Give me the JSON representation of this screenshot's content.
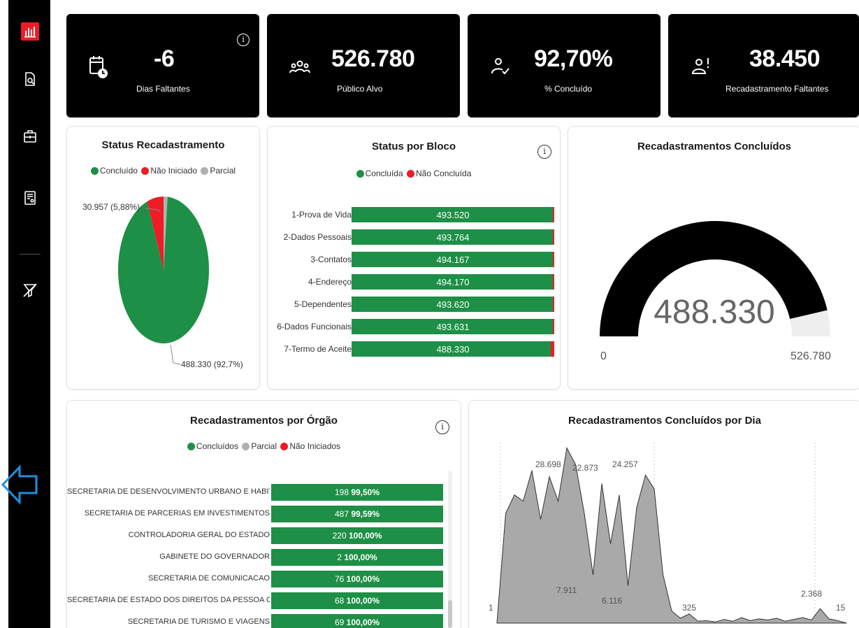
{
  "sidebar": {
    "items": [
      {
        "name": "report-icon",
        "active": true
      },
      {
        "name": "search-document-icon"
      },
      {
        "name": "briefcase-icon"
      },
      {
        "name": "profile-document-icon"
      },
      {
        "name": "clear-filter-icon"
      }
    ],
    "accent": "#ee1c25"
  },
  "kpis": [
    {
      "value": "-6",
      "label": "Dias Faltantes",
      "icon": "calendar-clock-icon",
      "info": "i"
    },
    {
      "value": "526.780",
      "label": "Público Alvo",
      "icon": "people-group-icon"
    },
    {
      "value": "92,70%",
      "label": "% Concluído",
      "icon": "user-check-icon"
    },
    {
      "value": "38.450",
      "label": "Recadastramento Faltantes",
      "icon": "user-alert-icon"
    }
  ],
  "status_recadastramento": {
    "title": "Status Recadastramento",
    "legend": [
      "Concluído",
      "Não Iniciado",
      "Parcial"
    ],
    "labels": {
      "top": "30.957 (5,88%)",
      "bottom": "488.330 (92,7%)"
    }
  },
  "status_bloco": {
    "title": "Status por Bloco",
    "legend": [
      "Concluída",
      "Não Concluída"
    ],
    "info": "i"
  },
  "gauge": {
    "title": "Recadastramentos Concluídos",
    "value": "488.330",
    "min": "0",
    "max": "526.780"
  },
  "orgao": {
    "title": "Recadastramentos por Órgão",
    "legend": [
      "Concluídos",
      "Parcial",
      "Não Iniciados"
    ],
    "info": "i",
    "rows": [
      {
        "name": "SECRETARIA DE DESENVOLVIMENTO URBANO E HABIT...",
        "count": "198",
        "pct": "99,50%"
      },
      {
        "name": "SECRETARIA DE PARCERIAS EM INVESTIMENTOS",
        "count": "487",
        "pct": "99,59%"
      },
      {
        "name": "CONTROLADORIA GERAL DO ESTADO",
        "count": "220",
        "pct": "100,00%"
      },
      {
        "name": "GABINETE DO GOVERNADOR",
        "count": "2",
        "pct": "100,00%"
      },
      {
        "name": "SECRETARIA DE COMUNICACAO",
        "count": "76",
        "pct": "100,00%"
      },
      {
        "name": "SECRETARIA DE ESTADO DOS DIREITOS DA PESSOA CO...",
        "count": "68",
        "pct": "100,00%"
      },
      {
        "name": "SECRETARIA DE TURISMO E VIAGENS",
        "count": "69",
        "pct": "100,00%"
      }
    ]
  },
  "daily": {
    "title": "Recadastramentos Concluídos por Dia"
  },
  "chart_data": [
    {
      "type": "pie",
      "title": "Status Recadastramento",
      "labels": [
        "Concluído",
        "Não Iniciado",
        "Parcial"
      ],
      "values": [
        488330,
        30957,
        7493
      ],
      "colors": [
        "#1e8f46",
        "#ee1c25",
        "#b0b0b0"
      ]
    },
    {
      "type": "bar",
      "title": "Status por Bloco",
      "categories": [
        "1-Prova de Vida",
        "2-Dados Pessoais",
        "3-Contatos",
        "4-Endereço",
        "5-Dependentes",
        "6-Dados Funcionais",
        "7-Termo de Aceite"
      ],
      "series": [
        {
          "name": "Concluída",
          "values": [
            493520,
            493764,
            494167,
            494170,
            493620,
            493631,
            488330
          ],
          "labels": [
            "493.520",
            "493.764",
            "494.167",
            "494.170",
            "493.620",
            "493.631",
            "488.330"
          ]
        },
        {
          "name": "Não Concluída",
          "values": [
            3000,
            3000,
            3000,
            3000,
            3000,
            3000,
            8000
          ]
        }
      ],
      "colors": [
        "#1e8f46",
        "#ee1c25"
      ]
    },
    {
      "type": "area",
      "title": "Recadastramentos Concluídos por Dia",
      "y": [
        1,
        18000,
        21000,
        20000,
        25000,
        17000,
        24000,
        20000,
        28698,
        26000,
        18000,
        7911,
        22873,
        13000,
        21000,
        6116,
        19000,
        24257,
        22000,
        8000,
        2000,
        800,
        1500,
        325,
        400,
        200,
        600,
        300,
        900,
        400,
        700,
        500,
        800,
        300,
        600,
        900,
        500,
        2368,
        700,
        400,
        15
      ],
      "annotations": [
        "1",
        "28.698",
        "7.911",
        "22.873",
        "6.116",
        "24.257",
        "325",
        "2.368",
        "15"
      ],
      "fill": "#a9a9a9"
    }
  ]
}
